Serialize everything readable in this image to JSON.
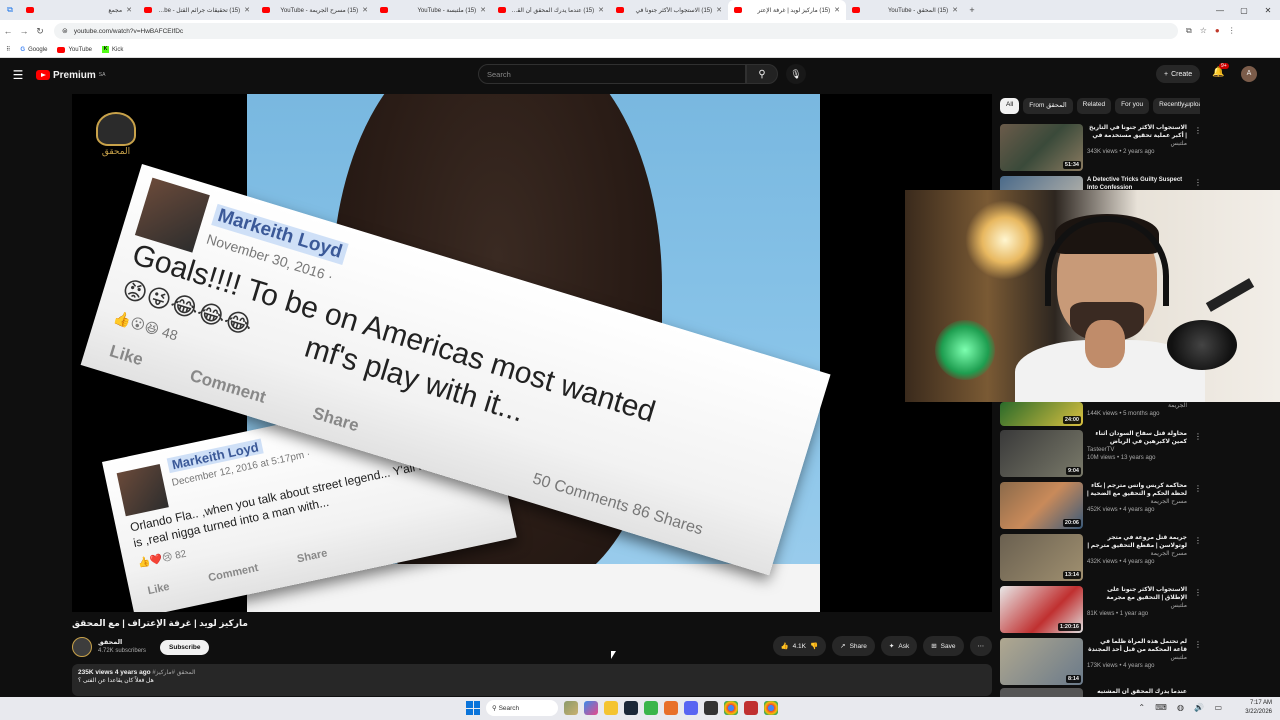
{
  "browser": {
    "tabs": [
      {
        "label": "مجمع",
        "active": false
      },
      {
        "label": "(15) تحقيقات جرائم القتل - YouTube",
        "active": false
      },
      {
        "label": "(15) مسرح الجريمة - YouTube",
        "active": false
      },
      {
        "label": "(15) ملتبسة - YouTube",
        "active": false
      },
      {
        "label": "(15) عندما يدرك المحقق أن القاتل",
        "active": false
      },
      {
        "label": "(15) الاستجواب الأكثر جنونا في",
        "active": false
      },
      {
        "label": "(15) ماركيز لويد | غرفة الإعتر",
        "active": true
      },
      {
        "label": "(15) المحقق - YouTube",
        "active": false
      }
    ],
    "new_tab": "+",
    "url": "youtube.com/watch?v=HwBAFCEIfDc",
    "bookmarks": [
      {
        "label": "Google"
      },
      {
        "label": "YouTube"
      },
      {
        "label": "Kick"
      }
    ]
  },
  "youtube": {
    "logo_text": "Premium",
    "logo_region": "SA",
    "search_placeholder": "Search",
    "create_label": "Create",
    "notif_badge": "9+",
    "avatar_letter": "A"
  },
  "video": {
    "fb1": {
      "name": "Markeith Loyd",
      "date": "November 30, 2016 ·",
      "text_line1": "Goals!!!! To be on Americas most wanted",
      "text_line2": "mf's play with it...",
      "emojis": "😡😜😂😂😂",
      "reactions": "👍😮😆 48",
      "like": "Like",
      "comment": "Comment",
      "share": "Share",
      "counts": "50 Comments   86 Shares"
    },
    "fb2": {
      "name": "Markeith Loyd",
      "date": "December 12, 2016 at 5:17pm ·",
      "text": "Orlando Fla.. ,when you talk about street legend... Y'all know what is ,real nigga turned into a man with...",
      "reactions": "👍❤️😢 82",
      "like": "Like",
      "comment": "Comment",
      "share": "Share"
    },
    "channel_watermark": "المحقق"
  },
  "below": {
    "title": "ماركيز لويد | غرفة الإعتراف | مع المحقق",
    "channel_name": "المحقق",
    "subscribers": "4.72K subscribers",
    "subscribe": "Subscribe",
    "likes": "4.1K",
    "share": "Share",
    "ask": "Ask",
    "save": "Save",
    "stats": "235K views  4 years ago",
    "tags": "#المحقق #ماركيز",
    "desc_line": "هل فعلاً كان يقاعدا عن الفتى ؟"
  },
  "sidebar": {
    "chips": [
      "All",
      "From المحقق",
      "Related",
      "For you",
      "Recently uploaded"
    ],
    "items": [
      {
        "title": "الاستجواب الأكثر جنونا في التاريخ | أكبر عملية تحقيق مستخدمة في حياتك",
        "channel": "ملتبس",
        "meta": "343K views • 2 years ago",
        "duration": "51:34"
      },
      {
        "title": "A Detective Tricks Guilty Suspect Into Confession",
        "channel": "",
        "meta": "",
        "duration": ""
      },
      {
        "title": "",
        "channel": "الجريمة",
        "meta": "144K views • 5 months ago",
        "duration": "24:00"
      },
      {
        "title": "محاولة قتل سفاح السودان أثناء كمين لاكبرهين في الرياض",
        "channel": "TasteerTV",
        "meta": "10M views • 13 years ago",
        "duration": "9:04"
      },
      {
        "title": "محاكمة كريس واتس مترجم | بكاء لحظة الحكم و التحقيق مع الضحية | تحقيقات جرائم",
        "channel": "مسرح الجريمة",
        "meta": "452K views • 4 years ago",
        "duration": "20:06"
      },
      {
        "title": "جريمة قتل مروعة في متجر لوتولاسن | مقطع التحقيق مترجم | تحقيقات جرائم القتل",
        "channel": "مسرح الجريمة",
        "meta": "432K views • 4 years ago",
        "duration": "13:14"
      },
      {
        "title": "الاستجواب الأكثر جنونا على الإطلاق | التحقيق مع مجرمة عمرها 12 عام",
        "channel": "ملتبس",
        "meta": "81K views • 1 year ago",
        "duration": "1:20:16"
      },
      {
        "title": "لم تحتمل هذه المرأة ظلماً في قاعة المحكمة من قبل أحد المجندة | الذي حاول القصر على",
        "channel": "ملتبس",
        "meta": "173K views • 4 years ago",
        "duration": "8:14"
      },
      {
        "title": "عندما يدرك المحقق أن المشتبه به...",
        "channel": "",
        "meta": "",
        "duration": ""
      }
    ]
  },
  "taskbar": {
    "search": "Search",
    "time": "7:17 AM",
    "date": "3/22/2026"
  }
}
